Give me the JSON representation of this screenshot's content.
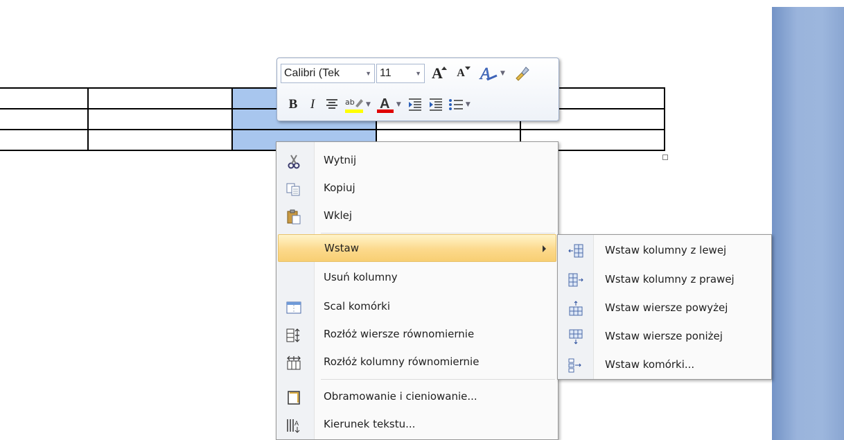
{
  "mini_toolbar": {
    "font_name": "Calibri (Tek",
    "font_size": "11",
    "bold": "B",
    "italic": "I",
    "grow_font": "A",
    "shrink_font": "A",
    "font_color_glyph": "A",
    "highlight_glyph": "ab"
  },
  "context_menu": {
    "items": [
      {
        "label": "Wytnij",
        "icon": "scissors-icon"
      },
      {
        "label": "Kopiuj",
        "icon": "copy-icon"
      },
      {
        "label": "Wklej",
        "icon": "paste-icon"
      },
      {
        "label": "Wstaw",
        "icon": "",
        "submenu": true
      },
      {
        "label": "Usuń kolumny",
        "icon": ""
      },
      {
        "label": "Scal komórki",
        "icon": "merge-cells-icon"
      },
      {
        "label": "Rozłóż wiersze równomiernie",
        "icon": "distribute-rows-icon"
      },
      {
        "label": "Rozłóż kolumny równomiernie",
        "icon": "distribute-columns-icon"
      },
      {
        "label": "Obramowanie i cieniowanie...",
        "icon": "borders-icon"
      },
      {
        "label": "Kierunek tekstu...",
        "icon": "text-direction-icon"
      }
    ]
  },
  "submenu": {
    "items": [
      {
        "label": "Wstaw kolumny z lewej",
        "icon": "insert-column-left-icon"
      },
      {
        "label": "Wstaw kolumny z prawej",
        "icon": "insert-column-right-icon"
      },
      {
        "label": "Wstaw wiersze powyżej",
        "icon": "insert-row-above-icon"
      },
      {
        "label": "Wstaw wiersze poniżej",
        "icon": "insert-row-below-icon"
      },
      {
        "label": "Wstaw komórki...",
        "icon": "insert-cells-icon"
      }
    ]
  },
  "colors": {
    "selection": "#a8c6ee",
    "hover": "#fcd98c",
    "font_color_underline": "#e00000",
    "highlight_underline": "#ffff00"
  }
}
